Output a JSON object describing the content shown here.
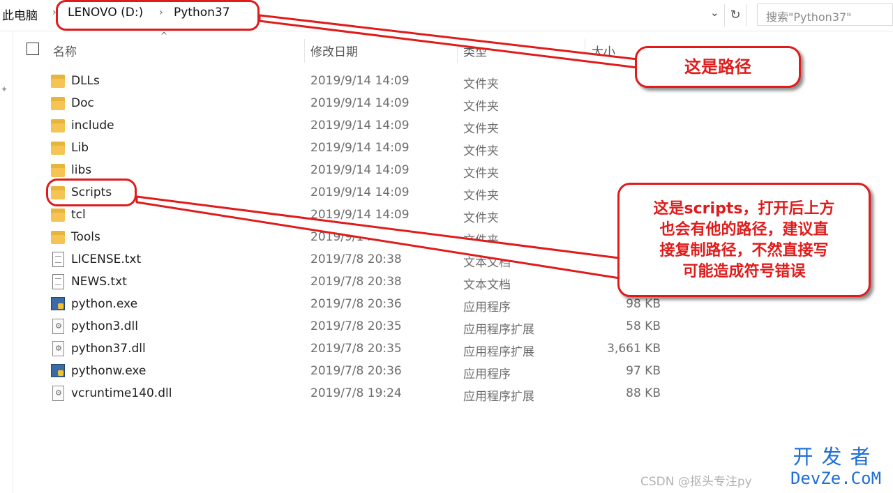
{
  "address_bar": {
    "crumbs": [
      "此电脑",
      "LENOVO (D:)",
      "Python37"
    ],
    "search_placeholder": "搜索\"Python37\""
  },
  "columns": {
    "name": "名称",
    "date": "修改日期",
    "type": "类型",
    "size": "大小"
  },
  "files": [
    {
      "name": "DLLs",
      "date": "2019/9/14 14:09",
      "type": "文件夹",
      "size": "",
      "icon": "folder-icon"
    },
    {
      "name": "Doc",
      "date": "2019/9/14 14:09",
      "type": "文件夹",
      "size": "",
      "icon": "folder-icon"
    },
    {
      "name": "include",
      "date": "2019/9/14 14:09",
      "type": "文件夹",
      "size": "",
      "icon": "folder-icon"
    },
    {
      "name": "Lib",
      "date": "2019/9/14 14:09",
      "type": "文件夹",
      "size": "",
      "icon": "folder-icon"
    },
    {
      "name": "libs",
      "date": "2019/9/14 14:09",
      "type": "文件夹",
      "size": "",
      "icon": "folder-icon"
    },
    {
      "name": "Scripts",
      "date": "2019/9/14 14:09",
      "type": "文件夹",
      "size": "",
      "icon": "folder-icon"
    },
    {
      "name": "tcl",
      "date": "2019/9/14 14:09",
      "type": "文件夹",
      "size": "",
      "icon": "folder-icon"
    },
    {
      "name": "Tools",
      "date": "2019/9/14 14:09",
      "type": "文件夹",
      "size": "",
      "icon": "folder-icon"
    },
    {
      "name": "LICENSE.txt",
      "date": "2019/7/8 20:38",
      "type": "文本文档",
      "size": "",
      "icon": "text-file-icon"
    },
    {
      "name": "NEWS.txt",
      "date": "2019/7/8 20:38",
      "type": "文本文档",
      "size": "",
      "icon": "text-file-icon"
    },
    {
      "name": "python.exe",
      "date": "2019/7/8 20:36",
      "type": "应用程序",
      "size": "98 KB",
      "icon": "python-exe-icon"
    },
    {
      "name": "python3.dll",
      "date": "2019/7/8 20:35",
      "type": "应用程序扩展",
      "size": "58 KB",
      "icon": "dll-file-icon"
    },
    {
      "name": "python37.dll",
      "date": "2019/7/8 20:35",
      "type": "应用程序扩展",
      "size": "3,661 KB",
      "icon": "dll-file-icon"
    },
    {
      "name": "pythonw.exe",
      "date": "2019/7/8 20:36",
      "type": "应用程序",
      "size": "97 KB",
      "icon": "python-exe-icon"
    },
    {
      "name": "vcruntime140.dll",
      "date": "2019/7/8 19:24",
      "type": "应用程序扩展",
      "size": "88 KB",
      "icon": "dll-file-icon"
    }
  ],
  "annotations": {
    "path_note": "这是路径",
    "scripts_note_lines": [
      "这是scripts，打开后上方",
      "也会有他的路径，建议直",
      "接复制路径，不然直接写",
      "可能造成符号错误"
    ],
    "accent_color": "#e01b1b"
  },
  "watermarks": {
    "csdn": "CSDN @抠头专注py",
    "devze_top": "开发者",
    "devze_bottom": "DevZe.CoM"
  }
}
